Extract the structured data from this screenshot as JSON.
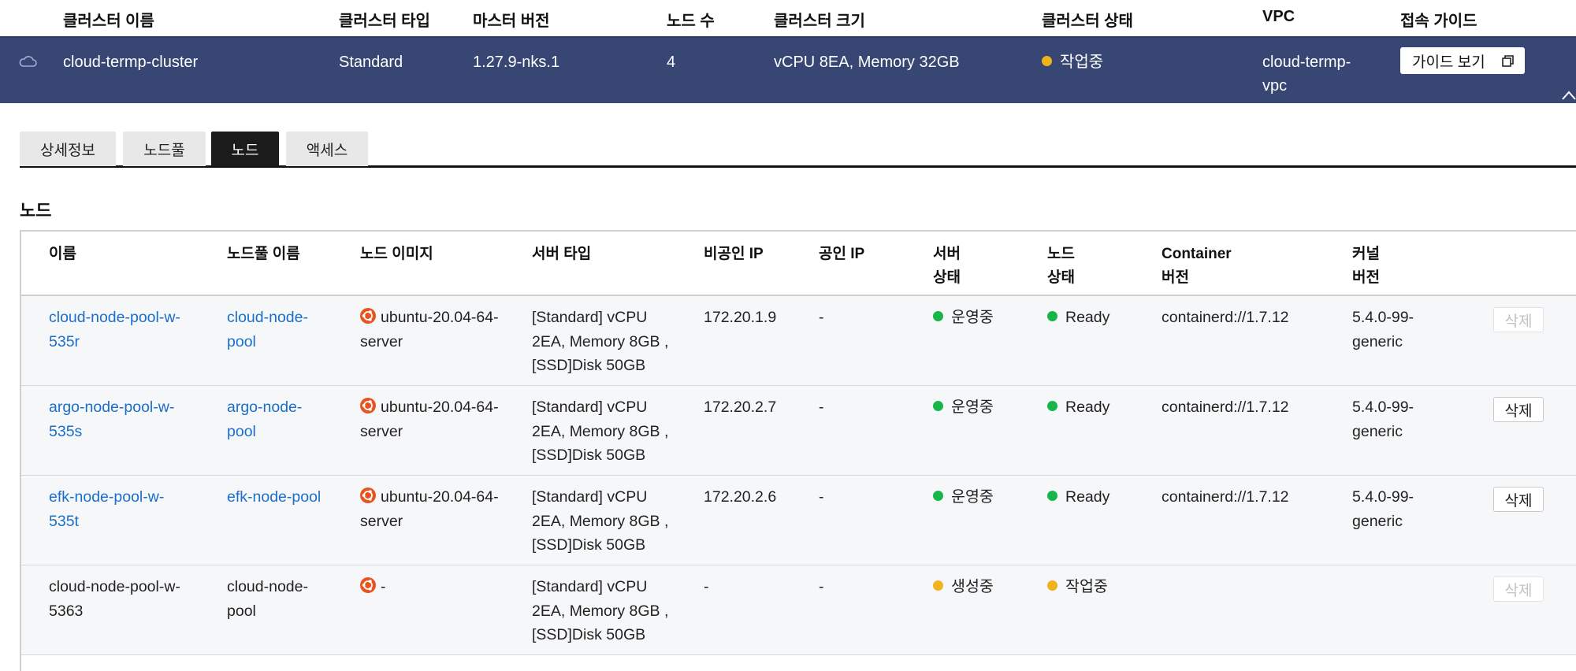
{
  "cluster_table": {
    "headers": {
      "name": "클러스터 이름",
      "type": "클러스터 타입",
      "master_version": "마스터 버전",
      "node_count": "노드 수",
      "size": "클러스터 크기",
      "status": "클러스터 상태",
      "vpc": "VPC",
      "guide": "접속 가이드"
    },
    "row": {
      "name": "cloud-termp-cluster",
      "type": "Standard",
      "master_version": "1.27.9-nks.1",
      "node_count": "4",
      "size": "vCPU 8EA, Memory 32GB",
      "status": "작업중",
      "status_color": "#f0b31c",
      "vpc_line1": "cloud-termp-",
      "vpc_line2": "vpc",
      "guide_button": "가이드 보기"
    },
    "row_background": "#374672"
  },
  "tabs": [
    {
      "label": "상세정보",
      "active": false
    },
    {
      "label": "노드풀",
      "active": false
    },
    {
      "label": "노드",
      "active": true
    },
    {
      "label": "액세스",
      "active": false
    }
  ],
  "section_title": "노드",
  "nodes_table": {
    "headers": {
      "name": "이름",
      "pool": "노드풀 이름",
      "image": "노드 이미지",
      "server_type": "서버 타입",
      "private_ip": "비공인 IP",
      "public_ip": "공인 IP",
      "server_status_1": "서버",
      "server_status_2": "상태",
      "node_status_1": "노드",
      "node_status_2": "상태",
      "container_1": "Container",
      "container_2": "버전",
      "kernel_1": "커널",
      "kernel_2": "버전"
    },
    "rows": [
      {
        "name_1": "cloud-node-pool-w-",
        "name_2": "535r",
        "name_link": true,
        "pool_1": "cloud-node-",
        "pool_2": "pool",
        "pool_link": true,
        "image_1": "ubuntu-20.04-64-",
        "image_2": "server",
        "type_1": "[Standard] vCPU",
        "type_2": "2EA, Memory 8GB ,",
        "type_3": "[SSD]Disk 50GB",
        "private_ip": "172.20.1.9",
        "public_ip": "-",
        "server_status": "운영중",
        "server_status_color": "#17b64a",
        "node_status": "Ready",
        "node_status_color": "#17b64a",
        "container": "containerd://1.7.12",
        "kernel_1": "5.4.0-99-",
        "kernel_2": "generic",
        "delete_label": "삭제",
        "delete_enabled": false
      },
      {
        "name_1": "argo-node-pool-w-",
        "name_2": "535s",
        "name_link": true,
        "pool_1": "argo-node-",
        "pool_2": "pool",
        "pool_link": true,
        "image_1": "ubuntu-20.04-64-",
        "image_2": "server",
        "type_1": "[Standard] vCPU",
        "type_2": "2EA, Memory 8GB ,",
        "type_3": "[SSD]Disk 50GB",
        "private_ip": "172.20.2.7",
        "public_ip": "-",
        "server_status": "운영중",
        "server_status_color": "#17b64a",
        "node_status": "Ready",
        "node_status_color": "#17b64a",
        "container": "containerd://1.7.12",
        "kernel_1": "5.4.0-99-",
        "kernel_2": "generic",
        "delete_label": "삭제",
        "delete_enabled": true
      },
      {
        "name_1": "efk-node-pool-w-",
        "name_2": "535t",
        "name_link": true,
        "pool_1": "efk-node-pool",
        "pool_2": "",
        "pool_link": true,
        "image_1": "ubuntu-20.04-64-",
        "image_2": "server",
        "type_1": "[Standard] vCPU",
        "type_2": "2EA, Memory 8GB ,",
        "type_3": "[SSD]Disk 50GB",
        "private_ip": "172.20.2.6",
        "public_ip": "-",
        "server_status": "운영중",
        "server_status_color": "#17b64a",
        "node_status": "Ready",
        "node_status_color": "#17b64a",
        "container": "containerd://1.7.12",
        "kernel_1": "5.4.0-99-",
        "kernel_2": "generic",
        "delete_label": "삭제",
        "delete_enabled": true
      },
      {
        "name_1": "cloud-node-pool-w-",
        "name_2": "5363",
        "name_link": false,
        "pool_1": "cloud-node-",
        "pool_2": "pool",
        "pool_link": false,
        "image_1": "-",
        "image_2": "",
        "type_1": "[Standard] vCPU",
        "type_2": "2EA, Memory 8GB ,",
        "type_3": "[SSD]Disk 50GB",
        "private_ip": "-",
        "public_ip": "-",
        "server_status": "생성중",
        "server_status_color": "#f0b31c",
        "node_status": "작업중",
        "node_status_color": "#f0b31c",
        "container": "",
        "kernel_1": "",
        "kernel_2": "",
        "delete_label": "삭제",
        "delete_enabled": false
      }
    ],
    "link_color": "#1a6fc9",
    "ubuntu_icon_color": "#e9531f"
  }
}
